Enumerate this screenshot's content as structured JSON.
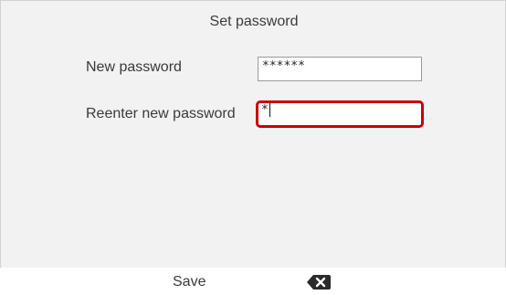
{
  "screen": {
    "title": "Set password"
  },
  "form": {
    "new_password": {
      "label": "New password",
      "value": "******"
    },
    "reenter_password": {
      "label": "Reenter new password",
      "value": "*"
    }
  },
  "softkeys": {
    "save_label": "Save",
    "backspace_icon": "backspace-icon"
  },
  "colors": {
    "focus_border": "#cc0000",
    "background": "#f2f2f2"
  }
}
